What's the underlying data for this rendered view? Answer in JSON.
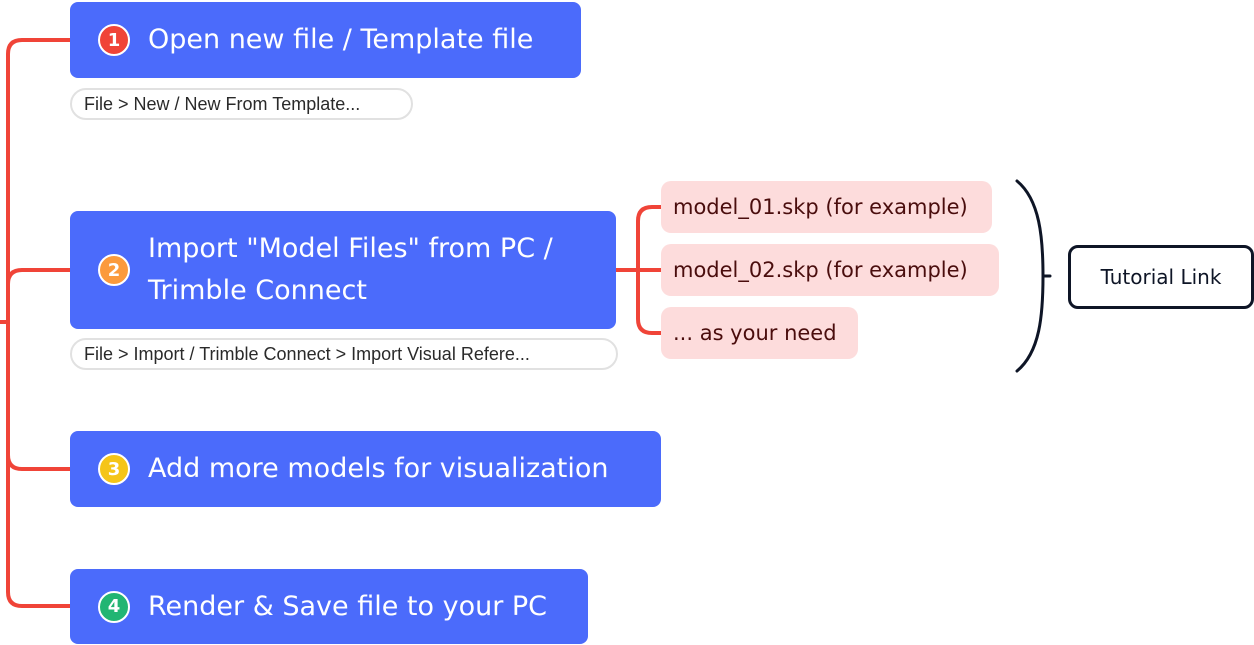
{
  "colors": {
    "step_fill": "#4b6bfb",
    "connector": "#f04438",
    "file_fill": "#fddcdc",
    "file_text": "#4a0d0d",
    "brace": "#0e1526"
  },
  "steps": [
    {
      "number": "1",
      "badge_color": "#f04438",
      "label": "Open new file / Template file",
      "note": "File > New / New From Template..."
    },
    {
      "number": "2",
      "badge_color": "#fb9a3c",
      "label_line1": "Import \"Model Files\" from PC /",
      "label_line2": "Trimble Connect",
      "note": "File > Import / Trimble Connect > Import Visual Refere..."
    },
    {
      "number": "3",
      "badge_color": "#f5c518",
      "label": "Add more models for visualization"
    },
    {
      "number": "4",
      "badge_color": "#22b573",
      "label": "Render & Save file to your PC"
    }
  ],
  "model_files": [
    "model_01.skp (for example)",
    "model_02.skp (for example)",
    "... as your need"
  ],
  "tutorial_label": "Tutorial Link"
}
